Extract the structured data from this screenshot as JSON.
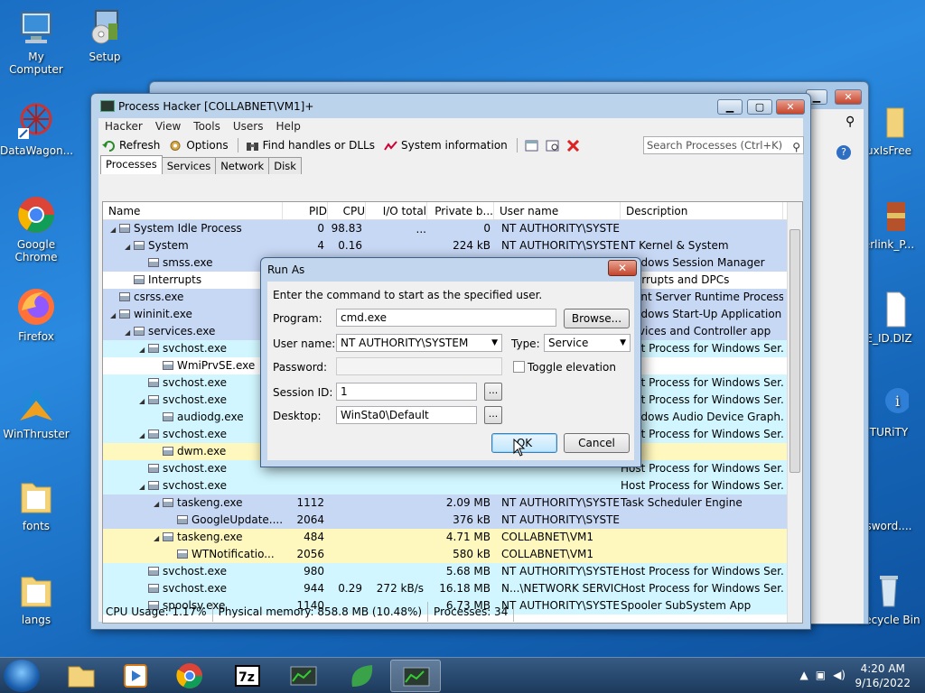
{
  "desktop_icons": [
    {
      "name": "my-computer",
      "label": "My Computer"
    },
    {
      "name": "setup",
      "label": "Setup"
    },
    {
      "name": "datawagon",
      "label": "DataWagon..."
    },
    {
      "name": "google-chrome",
      "label": "Google Chrome"
    },
    {
      "name": "firefox",
      "label": "Firefox"
    },
    {
      "name": "winthruster",
      "label": "WinThruster"
    },
    {
      "name": "fonts",
      "label": "fonts"
    },
    {
      "name": "langs",
      "label": "langs"
    },
    {
      "name": "uxisfree",
      "label": "uxIsFree"
    },
    {
      "name": "erlink",
      "label": "erlink_P..."
    },
    {
      "name": "id-diz",
      "label": "E_ID.DIZ"
    },
    {
      "name": "turity",
      "label": "TURiTY"
    },
    {
      "name": "sword",
      "label": "sword...."
    },
    {
      "name": "recycle-bin",
      "label": "Recycle Bin"
    }
  ],
  "window": {
    "title": "Process Hacker [COLLABNET\\VM1]+",
    "controls": {
      "minimize": "▁",
      "maximize": "▢",
      "close": "✕"
    }
  },
  "menu": [
    "Hacker",
    "View",
    "Tools",
    "Users",
    "Help"
  ],
  "toolbar": {
    "refresh": "Refresh",
    "options": "Options",
    "find_handles": "Find handles or DLLs",
    "system_info": "System information",
    "search_placeholder": "Search Processes (Ctrl+K)"
  },
  "tabs": [
    "Processes",
    "Services",
    "Network",
    "Disk"
  ],
  "columns": [
    "Name",
    "PID",
    "CPU",
    "I/O total ...",
    "Private b...",
    "User name",
    "Description"
  ],
  "rows": [
    {
      "indent": 0,
      "exp": "◢",
      "name": "System Idle Process",
      "pid": "0",
      "cpu": "98.83",
      "io": "",
      "priv": "0",
      "user": "NT AUTHORITY\\SYSTEM",
      "desc": "",
      "bg": "#c7d8f5"
    },
    {
      "indent": 1,
      "exp": "◢",
      "name": "System",
      "pid": "4",
      "cpu": "0.16",
      "io": "",
      "priv": "224 kB",
      "user": "NT AUTHORITY\\SYSTEM",
      "desc": "NT Kernel & System",
      "bg": "#c7d8f5"
    },
    {
      "indent": 2,
      "exp": "",
      "name": "smss.exe",
      "pid": "268",
      "cpu": "",
      "io": "",
      "priv": "612 kB",
      "user": "NT AUTHORITY\\SYSTEM",
      "desc": "Windows Session Manager",
      "bg": "#c7d8f5"
    },
    {
      "indent": 1,
      "exp": "",
      "name": "Interrupts",
      "pid": "",
      "cpu": "0.31",
      "io": "",
      "priv": "0",
      "user": "",
      "desc": "Interrupts and DPCs",
      "bg": "#ffffff"
    },
    {
      "indent": 0,
      "exp": "",
      "name": "csrss.exe",
      "pid": "",
      "cpu": "",
      "io": "",
      "priv": "",
      "user": "",
      "desc": "Client Server Runtime Process",
      "bg": "#c7d8f5"
    },
    {
      "indent": 0,
      "exp": "◢",
      "name": "wininit.exe",
      "pid": "",
      "cpu": "",
      "io": "",
      "priv": "",
      "user": "",
      "desc": "Windows Start-Up Application",
      "bg": "#c7d8f5"
    },
    {
      "indent": 1,
      "exp": "◢",
      "name": "services.exe",
      "pid": "",
      "cpu": "",
      "io": "",
      "priv": "",
      "user": "",
      "desc": "Services and Controller app",
      "bg": "#c7d8f5"
    },
    {
      "indent": 2,
      "exp": "◢",
      "name": "svchost.exe",
      "pid": "",
      "cpu": "",
      "io": "",
      "priv": "",
      "user": "",
      "desc": "Host Process for Windows Ser...",
      "bg": "#d1f6ff"
    },
    {
      "indent": 3,
      "exp": "",
      "name": "WmiPrvSE.exe",
      "pid": "",
      "cpu": "",
      "io": "",
      "priv": "",
      "user": "",
      "desc": "",
      "bg": "#ffffff"
    },
    {
      "indent": 2,
      "exp": "",
      "name": "svchost.exe",
      "pid": "",
      "cpu": "",
      "io": "",
      "priv": "",
      "user": "",
      "desc": "Host Process for Windows Ser...",
      "bg": "#d1f6ff"
    },
    {
      "indent": 2,
      "exp": "◢",
      "name": "svchost.exe",
      "pid": "",
      "cpu": "",
      "io": "",
      "priv": "",
      "user": "",
      "desc": "Host Process for Windows Ser...",
      "bg": "#d1f6ff"
    },
    {
      "indent": 3,
      "exp": "",
      "name": "audiodg.exe",
      "pid": "",
      "cpu": "",
      "io": "",
      "priv": "",
      "user": "",
      "desc": "Windows Audio Device Graph...",
      "bg": "#d1f6ff"
    },
    {
      "indent": 2,
      "exp": "◢",
      "name": "svchost.exe",
      "pid": "",
      "cpu": "",
      "io": "",
      "priv": "",
      "user": "",
      "desc": "Host Process for Windows Ser...",
      "bg": "#d1f6ff"
    },
    {
      "indent": 3,
      "exp": "",
      "name": "dwm.exe",
      "pid": "",
      "cpu": "",
      "io": "",
      "priv": "",
      "user": "",
      "desc": "",
      "bg": "#fff8be"
    },
    {
      "indent": 2,
      "exp": "",
      "name": "svchost.exe",
      "pid": "",
      "cpu": "",
      "io": "",
      "priv": "",
      "user": "",
      "desc": "Host Process for Windows Ser...",
      "bg": "#d1f6ff"
    },
    {
      "indent": 2,
      "exp": "◢",
      "name": "svchost.exe",
      "pid": "",
      "cpu": "",
      "io": "",
      "priv": "",
      "user": "",
      "desc": "Host Process for Windows Ser...",
      "bg": "#d1f6ff"
    },
    {
      "indent": 3,
      "exp": "◢",
      "name": "taskeng.exe",
      "pid": "1112",
      "cpu": "",
      "io": "",
      "priv": "2.09 MB",
      "user": "NT AUTHORITY\\SYSTEM",
      "desc": "Task Scheduler Engine",
      "bg": "#c7d8f5"
    },
    {
      "indent": 4,
      "exp": "",
      "name": "GoogleUpdate....",
      "pid": "2064",
      "cpu": "",
      "io": "",
      "priv": "376 kB",
      "user": "NT AUTHORITY\\SYSTEM",
      "desc": "",
      "bg": "#c7d8f5"
    },
    {
      "indent": 3,
      "exp": "◢",
      "name": "taskeng.exe",
      "pid": "484",
      "cpu": "",
      "io": "",
      "priv": "4.71 MB",
      "user": "COLLABNET\\VM1",
      "desc": "",
      "bg": "#fff8be"
    },
    {
      "indent": 4,
      "exp": "",
      "name": "WTNotificatio...",
      "pid": "2056",
      "cpu": "",
      "io": "",
      "priv": "580 kB",
      "user": "COLLABNET\\VM1",
      "desc": "",
      "bg": "#fff8be"
    },
    {
      "indent": 2,
      "exp": "",
      "name": "svchost.exe",
      "pid": "980",
      "cpu": "",
      "io": "",
      "priv": "5.68 MB",
      "user": "NT AUTHORITY\\SYSTEM",
      "desc": "Host Process for Windows Ser...",
      "bg": "#d1f6ff"
    },
    {
      "indent": 2,
      "exp": "",
      "name": "svchost.exe",
      "pid": "944",
      "cpu": "0.29",
      "io": "272 kB/s",
      "priv": "16.18 MB",
      "user": "N...\\NETWORK SERVICE",
      "desc": "Host Process for Windows Ser...",
      "bg": "#d1f6ff"
    },
    {
      "indent": 2,
      "exp": "",
      "name": "spoolsv.exe",
      "pid": "1140",
      "cpu": "",
      "io": "",
      "priv": "6.73 MB",
      "user": "NT AUTHORITY\\SYSTEM",
      "desc": "Spooler SubSystem App",
      "bg": "#d1f6ff"
    }
  ],
  "status": {
    "cpu": "CPU Usage: 1.17%",
    "memory": "Physical memory: 858.8 MB (10.48%)",
    "processes": "Processes: 34"
  },
  "dialog": {
    "title": "Run As",
    "instruction": "Enter the command to start as the specified user.",
    "program_label": "Program:",
    "program_value": "cmd.exe",
    "browse": "Browse...",
    "username_label": "User name:",
    "username_value": "NT AUTHORITY\\SYSTEM",
    "type_label": "Type:",
    "type_value": "Service",
    "password_label": "Password:",
    "toggle_elevation": "Toggle elevation",
    "session_label": "Session ID:",
    "session_value": "1",
    "desktop_label": "Desktop:",
    "desktop_value": "WinSta0\\Default",
    "ellipsis": "...",
    "ok": "OK",
    "cancel": "Cancel"
  },
  "taskbar": {
    "time": "4:20 AM",
    "date": "9/16/2022"
  },
  "colors": {
    "highlight_system": "#c7d8f5",
    "service": "#d1f6ff",
    "own_process": "#fff8be"
  }
}
